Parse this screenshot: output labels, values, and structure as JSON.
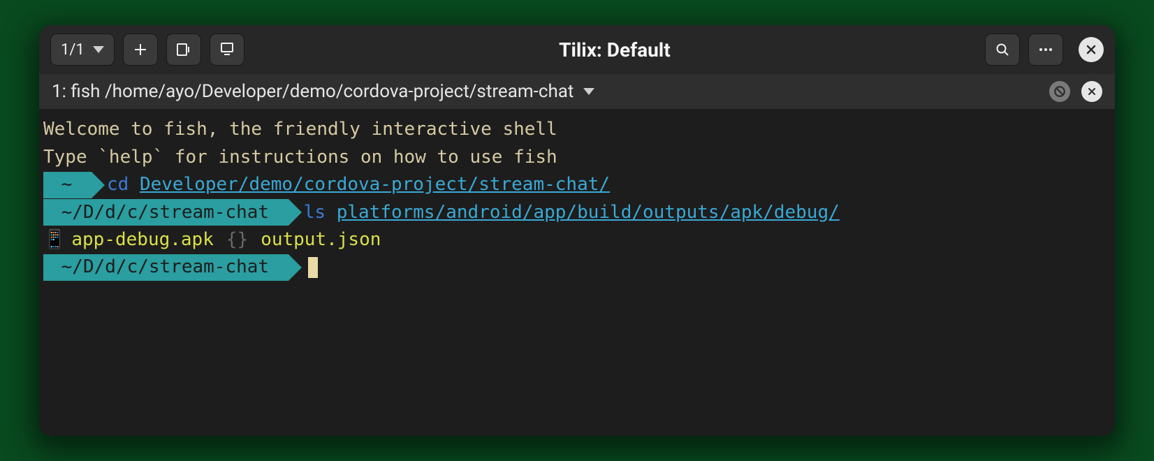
{
  "titlebar": {
    "session_counter": "1/1",
    "title": "Tilix: Default"
  },
  "session": {
    "label": "1: fish /home/ayo/Developer/demo/cordova-project/stream-chat"
  },
  "terminal": {
    "greet1": "Welcome to fish, the friendly interactive shell",
    "greet2": "Type `help` for instructions on how to use fish",
    "line1": {
      "prompt": " ~ ",
      "cmd": "cd",
      "arg": "Developer/demo/cordova-project/stream-chat/"
    },
    "line2": {
      "prompt": " ~/D/d/c/stream-chat ",
      "cmd": "ls",
      "arg": "platforms/android/app/build/outputs/apk/debug/"
    },
    "ls": {
      "icon1": "📱",
      "file1": "app-debug.apk",
      "sep": "{}",
      "file2": "output.json"
    },
    "line3": {
      "prompt": " ~/D/d/c/stream-chat "
    }
  }
}
